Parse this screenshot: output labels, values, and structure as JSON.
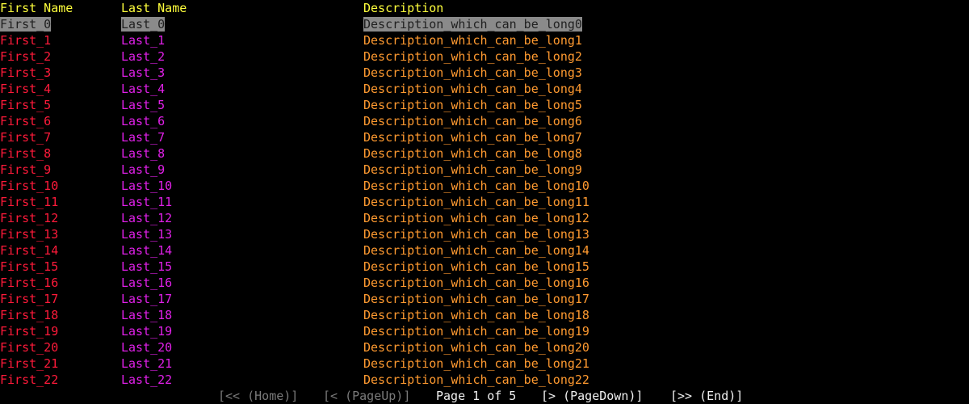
{
  "table": {
    "headers": [
      "First Name",
      "Last Name",
      "Description"
    ],
    "rows": [
      [
        "First_0",
        "Last_0",
        "Description_which_can_be_long0"
      ],
      [
        "First_1",
        "Last_1",
        "Description_which_can_be_long1"
      ],
      [
        "First_2",
        "Last_2",
        "Description_which_can_be_long2"
      ],
      [
        "First_3",
        "Last_3",
        "Description_which_can_be_long3"
      ],
      [
        "First_4",
        "Last_4",
        "Description_which_can_be_long4"
      ],
      [
        "First_5",
        "Last_5",
        "Description_which_can_be_long5"
      ],
      [
        "First_6",
        "Last_6",
        "Description_which_can_be_long6"
      ],
      [
        "First_7",
        "Last_7",
        "Description_which_can_be_long7"
      ],
      [
        "First_8",
        "Last_8",
        "Description_which_can_be_long8"
      ],
      [
        "First_9",
        "Last_9",
        "Description_which_can_be_long9"
      ],
      [
        "First_10",
        "Last_10",
        "Description_which_can_be_long10"
      ],
      [
        "First_11",
        "Last_11",
        "Description_which_can_be_long11"
      ],
      [
        "First_12",
        "Last_12",
        "Description_which_can_be_long12"
      ],
      [
        "First_13",
        "Last_13",
        "Description_which_can_be_long13"
      ],
      [
        "First_14",
        "Last_14",
        "Description_which_can_be_long14"
      ],
      [
        "First_15",
        "Last_15",
        "Description_which_can_be_long15"
      ],
      [
        "First_16",
        "Last_16",
        "Description_which_can_be_long16"
      ],
      [
        "First_17",
        "Last_17",
        "Description_which_can_be_long17"
      ],
      [
        "First_18",
        "Last_18",
        "Description_which_can_be_long18"
      ],
      [
        "First_19",
        "Last_19",
        "Description_which_can_be_long19"
      ],
      [
        "First_20",
        "Last_20",
        "Description_which_can_be_long20"
      ],
      [
        "First_21",
        "Last_21",
        "Description_which_can_be_long21"
      ],
      [
        "First_22",
        "Last_22",
        "Description_which_can_be_long22"
      ]
    ],
    "selected_row": 0
  },
  "footer": {
    "home": "[<< (Home)]",
    "page_up": "[< (PageUp)]",
    "page_info": "Page 1 of 5",
    "page_down": "[> (PageDown)]",
    "end": "[>> (End)]"
  },
  "colors": {
    "background": "#000000",
    "header": "#ffff3c",
    "first_name": "#ff1a3a",
    "last_name": "#e020e8",
    "description": "#ff9a30",
    "selection_bg": "#8a8a8a",
    "nav_disabled": "#7a7a7a",
    "nav_enabled": "#f0f0f0"
  }
}
